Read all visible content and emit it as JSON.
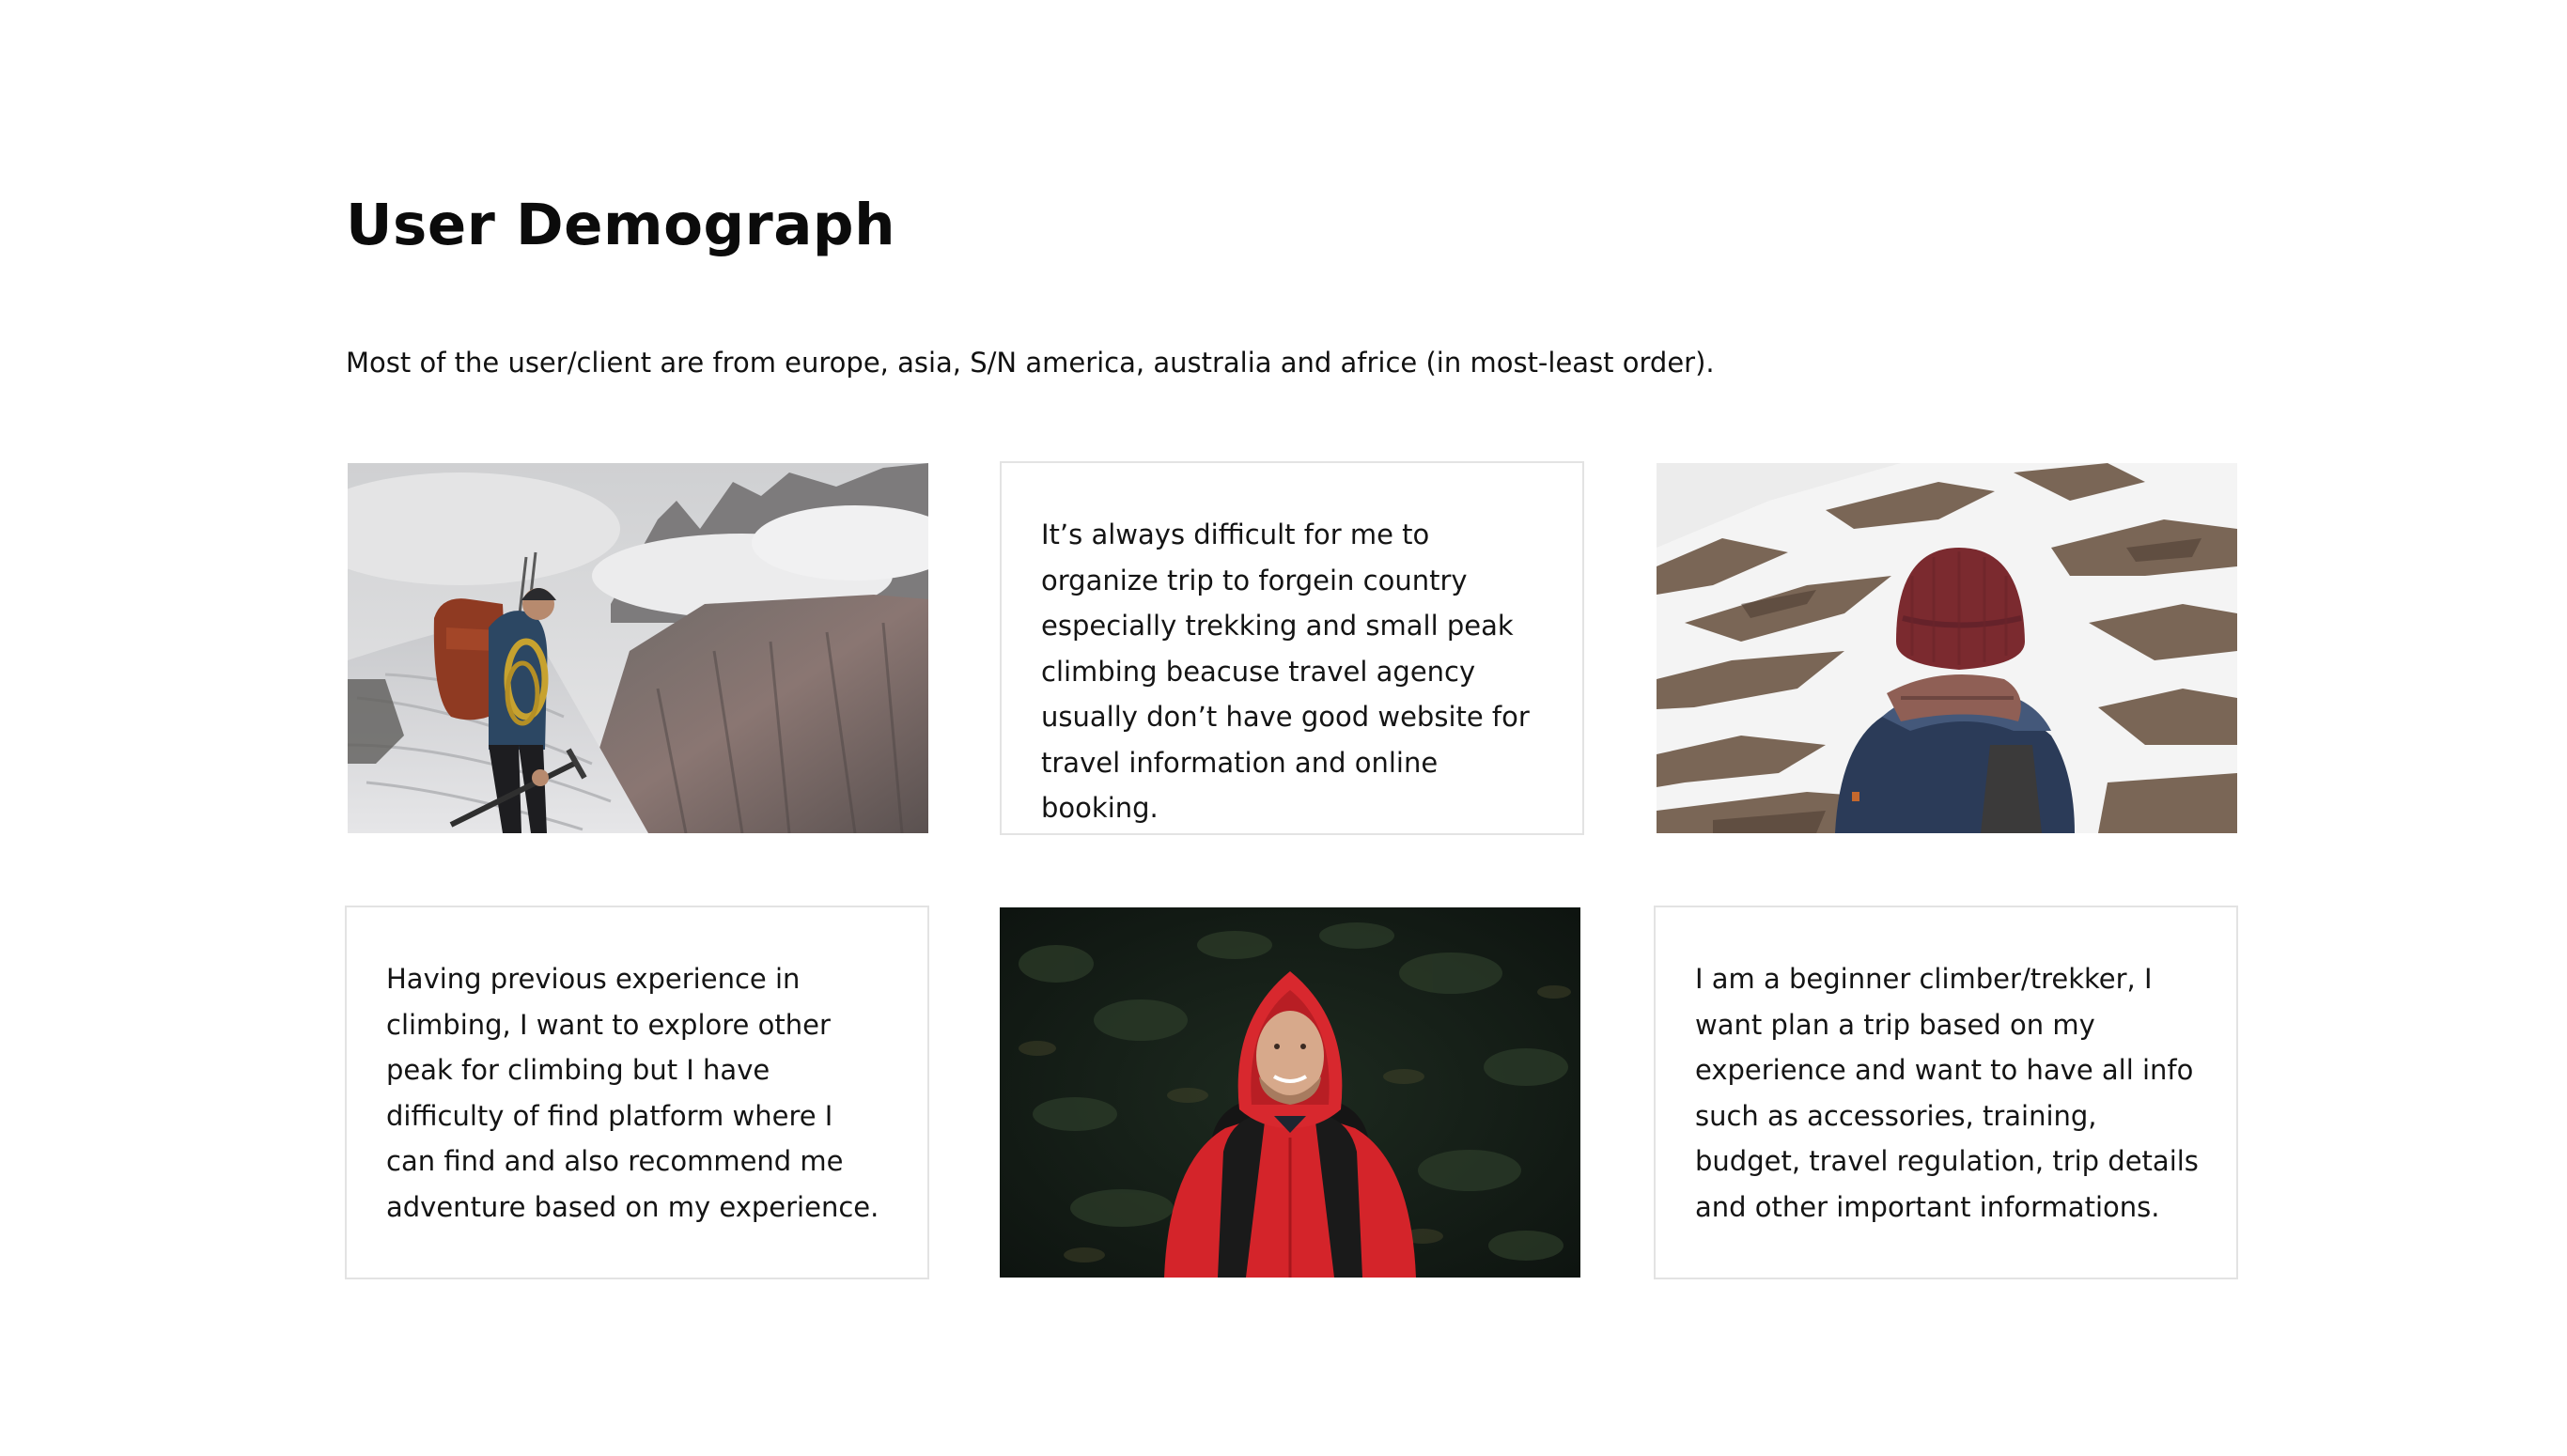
{
  "page": {
    "title": "User Demograph",
    "subtitle": "Most of the user/client are from europe, asia, S/N america, australia and africe (in most-least order)."
  },
  "cards": [
    {
      "type": "photo",
      "subject": "climber-with-backpack-and-ice-axe-on-glacier"
    },
    {
      "type": "quote",
      "text": "It’s always difficult for me to organize trip to forgein country especially trekking and small peak climbing beacuse travel agency usually don’t have good website for travel information and online booking."
    },
    {
      "type": "photo",
      "subject": "person-in-red-beanie-facing-snowy-mountain"
    },
    {
      "type": "quote",
      "text": "Having previous experience in climbing, I want to explore other peak for climbing but I have difficulty of find platform where I can find and also recommend me adventure based on my experience."
    },
    {
      "type": "photo",
      "subject": "smiling-man-in-red-hooded-jacket-in-forest"
    },
    {
      "type": "quote",
      "text": "I am a beginner climber/trekker, I want plan a trip based on my experience and want to have all info such as accessories, training, budget, travel regulation, trip details and other important informations."
    }
  ],
  "colors": {
    "background": "#ffffff",
    "text": "#111111",
    "card_border": "#e3e3e3",
    "jacket_red": "#d4242a"
  }
}
